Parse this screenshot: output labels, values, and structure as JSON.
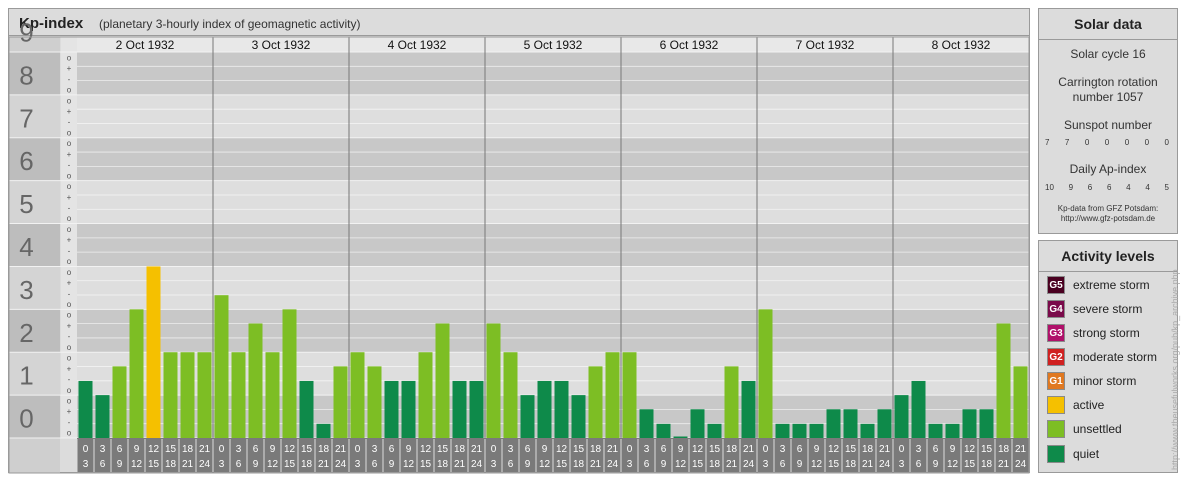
{
  "header": {
    "title": "Kp-index",
    "subtitle": "(planetary 3-hourly index of geomagnetic activity)"
  },
  "chart_data": {
    "type": "bar",
    "title": "Kp-index",
    "ylim": [
      0,
      9
    ],
    "y_ticks": [
      "0",
      "1",
      "2",
      "3",
      "4",
      "5",
      "6",
      "7",
      "8",
      "9"
    ],
    "y_minor_marks": [
      "o",
      "+",
      "-",
      "o"
    ],
    "days": [
      "2 Oct 1932",
      "3 Oct 1932",
      "4 Oct 1932",
      "5 Oct 1932",
      "6 Oct 1932",
      "7 Oct 1932",
      "8 Oct 1932"
    ],
    "hour_starts": [
      "0",
      "3",
      "6",
      "9",
      "12",
      "15",
      "18",
      "21"
    ],
    "hour_ends": [
      "3",
      "6",
      "9",
      "12",
      "15",
      "18",
      "21",
      "24"
    ],
    "values": [
      1.33,
      1.0,
      1.67,
      3.0,
      4.0,
      2.0,
      2.0,
      2.0,
      3.33,
      2.0,
      2.67,
      2.0,
      3.0,
      1.33,
      0.33,
      1.67,
      2.0,
      1.67,
      1.33,
      1.33,
      2.0,
      2.67,
      1.33,
      1.33,
      2.67,
      2.0,
      1.0,
      1.33,
      1.33,
      1.0,
      1.67,
      2.0,
      2.0,
      0.67,
      0.33,
      0.0,
      0.67,
      0.33,
      1.67,
      1.33,
      3.0,
      0.33,
      0.33,
      0.33,
      0.67,
      0.67,
      0.33,
      0.67,
      1.0,
      1.33,
      0.33,
      0.33,
      0.67,
      0.67,
      2.67,
      1.67
    ],
    "colors": {
      "quiet": "#0e8a4a",
      "unsettled": "#7dbe24",
      "active": "#f5c000",
      "minor_storm": "#e07820",
      "moderate_storm": "#d02020",
      "strong_storm": "#b0106a",
      "severe_storm": "#7a0a4a",
      "extreme_storm": "#4a0020"
    }
  },
  "solar": {
    "title": "Solar data",
    "cycle": "Solar cycle 16",
    "carrington_line1": "Carrington rotation",
    "carrington_line2": "number 1057",
    "sunspot_title": "Sunspot number",
    "sunspot_values": [
      "7",
      "7",
      "0",
      "0",
      "0",
      "0",
      "0"
    ],
    "ap_title": "Daily Ap-index",
    "ap_values": [
      "10",
      "9",
      "6",
      "6",
      "4",
      "4",
      "5"
    ],
    "source_line1": "Kp-data from GFZ Potsdam:",
    "source_line2": "http://www.gfz-potsdam.de"
  },
  "legend": {
    "title": "Activity levels",
    "items": [
      {
        "code": "G5",
        "label": "extreme storm",
        "color": "#4a0020"
      },
      {
        "code": "G4",
        "label": "severe storm",
        "color": "#7a0a4a"
      },
      {
        "code": "G3",
        "label": "strong storm",
        "color": "#b0106a"
      },
      {
        "code": "G2",
        "label": "moderate storm",
        "color": "#d02020"
      },
      {
        "code": "G1",
        "label": "minor storm",
        "color": "#e07820"
      },
      {
        "code": "",
        "label": "active",
        "color": "#f5c000"
      },
      {
        "code": "",
        "label": "unsettled",
        "color": "#7dbe24"
      },
      {
        "code": "",
        "label": "quiet",
        "color": "#0e8a4a"
      }
    ]
  },
  "watermark": "http://www.theusefulworks.org/pub/kp_archive.php"
}
